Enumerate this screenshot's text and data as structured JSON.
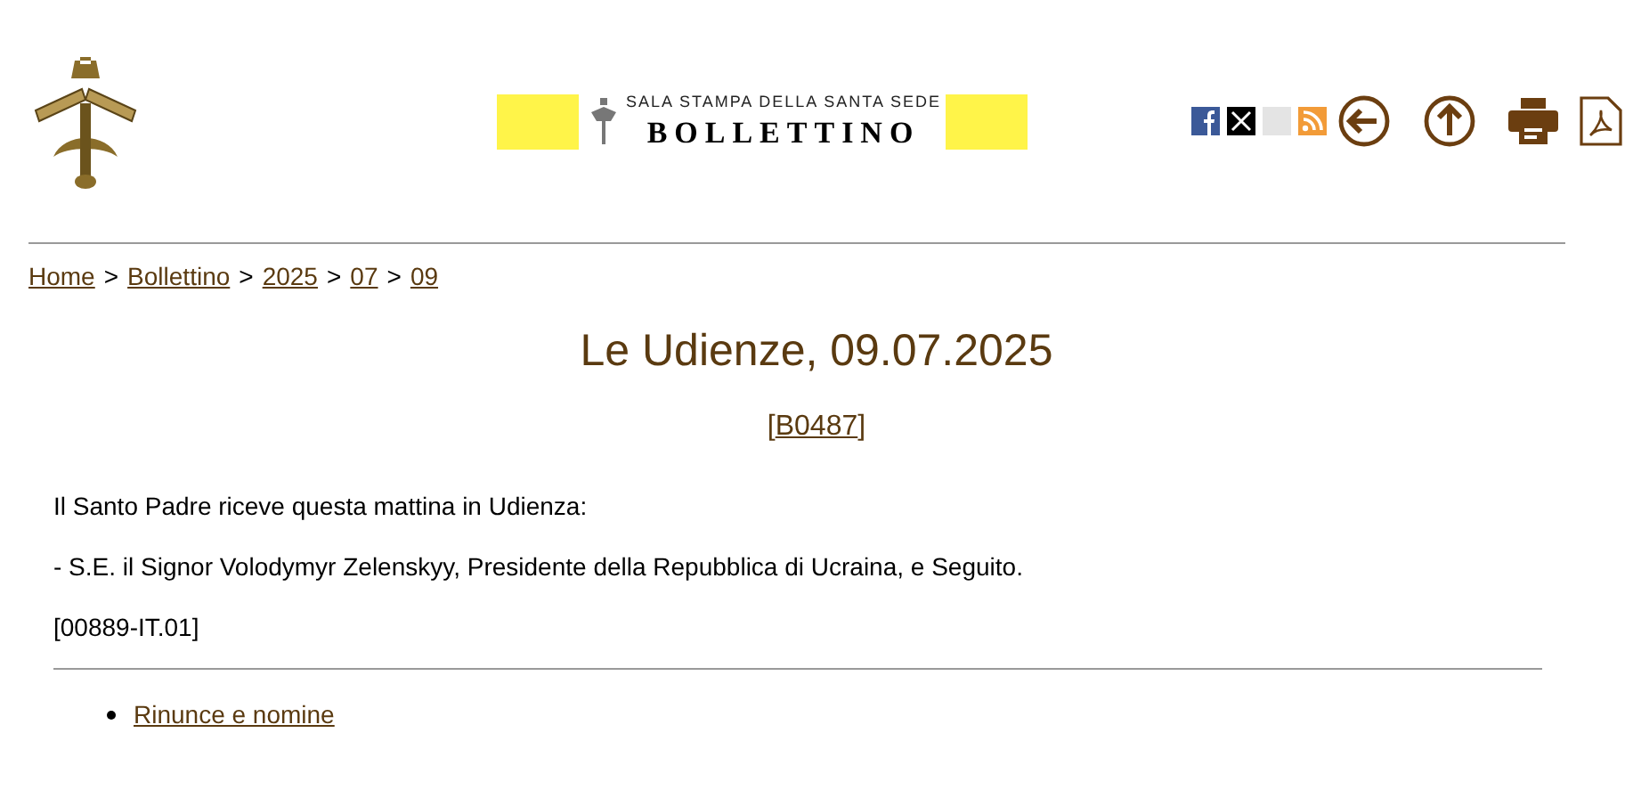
{
  "banner": {
    "subtitle": "SALA STAMPA DELLA SANTA SEDE",
    "title": "BOLLETTINO"
  },
  "breadcrumb": [
    "Home",
    "Bollettino",
    "2025",
    "07",
    "09"
  ],
  "breadcrumb_separator": ">",
  "heading": "Le Udienze, 09.07.2025",
  "code": {
    "open": "[",
    "link": "B0487",
    "close": "]"
  },
  "paragraphs": [
    "Il Santo Padre riceve questa mattina in Udienza:",
    "- S.E. il Signor Volodymyr Zelenskyy, Presidente della Repubblica di Ucraina, e Seguito.",
    "[00889-IT.01]"
  ],
  "links": [
    "Rinunce e nomine"
  ]
}
